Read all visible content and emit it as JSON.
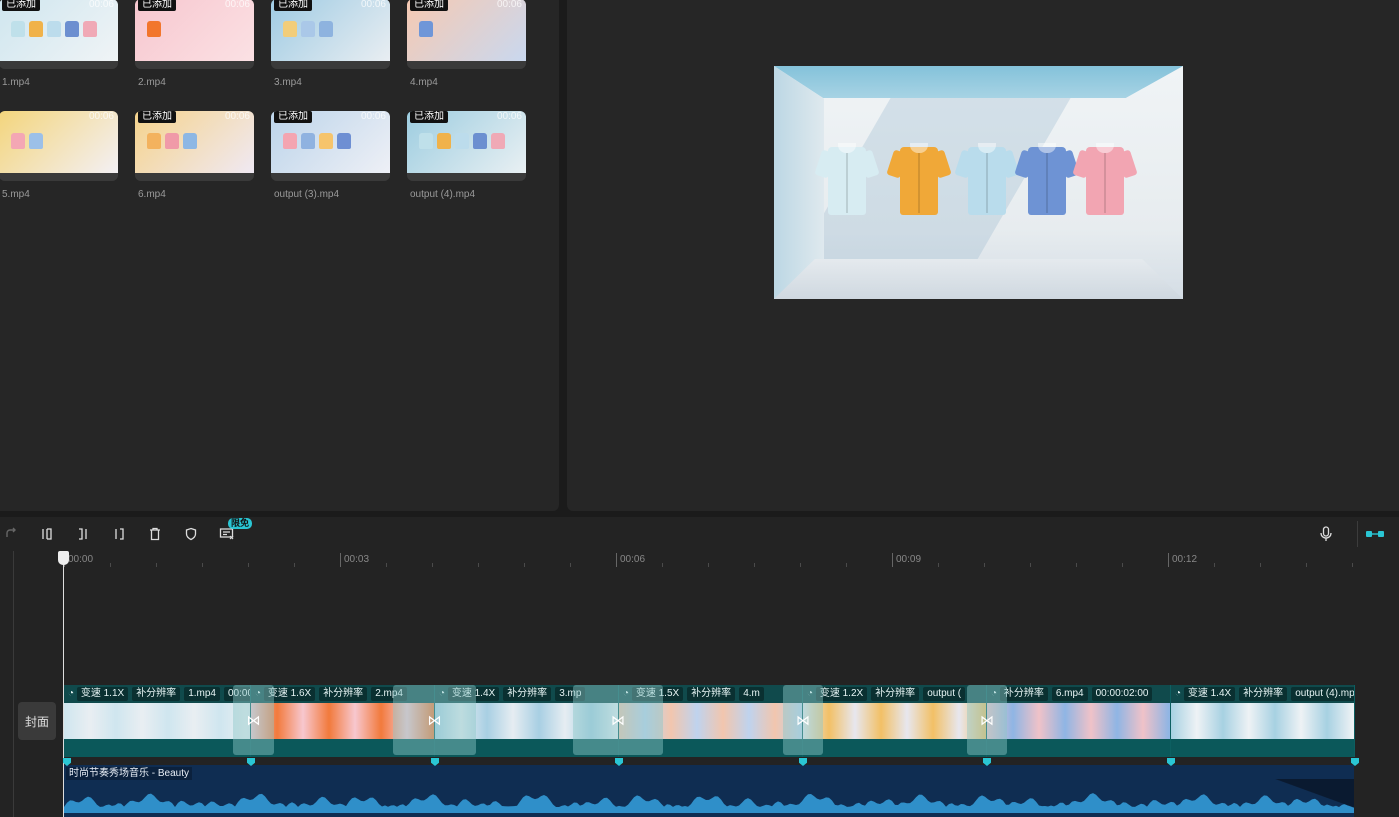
{
  "media": {
    "items": [
      {
        "name": "1.mp4",
        "badge": "已添加",
        "duration": "00:06",
        "colors": [
          "#cfe6ef",
          "#f0f4f6"
        ],
        "shirts": [
          "#bfe0ea",
          "#f0b24a",
          "#bcdcec",
          "#6c8fd0",
          "#f0a9b6"
        ]
      },
      {
        "name": "2.mp4",
        "badge": "已添加",
        "duration": "00:06",
        "colors": [
          "#f7c7cf",
          "#fbe1e4"
        ],
        "shirts": [
          "#f2762c"
        ]
      },
      {
        "name": "3.mp4",
        "badge": "已添加",
        "duration": "00:06",
        "colors": [
          "#9fcbe3",
          "#e9eef2"
        ],
        "shirts": [
          "#f2cd7a",
          "#aac8e8",
          "#8eb3df"
        ]
      },
      {
        "name": "4.mp4",
        "badge": "已添加",
        "duration": "00:06",
        "colors": [
          "#f6c9b2",
          "#c9d8ef"
        ],
        "shirts": [
          "#6f96d8"
        ]
      },
      {
        "name": "5.mp4",
        "badge": "",
        "duration": "00:06",
        "colors": [
          "#f3d57c",
          "#f3f0f4"
        ],
        "shirts": [
          "#f4a7b4",
          "#9cc0e8"
        ]
      },
      {
        "name": "6.mp4",
        "badge": "已添加",
        "duration": "00:06",
        "colors": [
          "#f5d38c",
          "#f0e9f3"
        ],
        "shirts": [
          "#f3b25e",
          "#f09aa8",
          "#8db7e4"
        ]
      },
      {
        "name": "output (3).mp4",
        "badge": "已添加",
        "duration": "00:06",
        "colors": [
          "#bcd4ea",
          "#eef0f6"
        ],
        "shirts": [
          "#f4a5b1",
          "#8fb2e0",
          "#f6c46c",
          "#6e8fd3"
        ]
      },
      {
        "name": "output (4).mp4",
        "badge": "已添加",
        "duration": "00:06",
        "colors": [
          "#9dcde0",
          "#e9f0f3"
        ],
        "shirts": [
          "#bfe0ea",
          "#f0b24a",
          "#bcdcec",
          "#6c8fd0",
          "#f0a9b6"
        ]
      }
    ]
  },
  "preview": {
    "shirts": [
      "#d7ecf2",
      "#f0a838",
      "#b9dcec",
      "#6e93d4",
      "#f2a5b2"
    ]
  },
  "toolbar": {
    "free_badge": "限免"
  },
  "ruler": {
    "labels": [
      "00:00",
      "00:03",
      "00:06",
      "00:09",
      "00:12"
    ]
  },
  "timeline": {
    "cover_label": "封面",
    "clips": [
      {
        "tags": [
          "变速 1.1X",
          "补分辨率",
          "1.mp4",
          "00:00:0"
        ],
        "colors": [
          "#cfe6ef",
          "#e9eef2"
        ]
      },
      {
        "tags": [
          "变速 1.6X",
          "补分辨率",
          "2.mp4"
        ],
        "colors": [
          "#f7c7cf",
          "#f27a3c"
        ]
      },
      {
        "tags": [
          "变速 1.4X",
          "补分辨率",
          "3.mp"
        ],
        "colors": [
          "#a8cfe3",
          "#e6edf2"
        ]
      },
      {
        "tags": [
          "变速 1.5X",
          "补分辨率",
          "4.m"
        ],
        "colors": [
          "#f2c6ae",
          "#bfd3ee"
        ]
      },
      {
        "tags": [
          "变速 1.2X",
          "补分辨率",
          "output ("
        ],
        "colors": [
          "#e7e7ef",
          "#f2c066"
        ]
      },
      {
        "tags": [
          "补分辨率",
          "6.mp4",
          "00:00:02:00"
        ],
        "colors": [
          "#f0c2c8",
          "#8fb5e4"
        ]
      },
      {
        "tags": [
          "变速 1.4X",
          "补分辨率",
          "output (4).mp4"
        ],
        "colors": [
          "#a7d1e2",
          "#eef2f5"
        ]
      }
    ],
    "audio_label": "时尚节奏秀场音乐 - Beauty"
  }
}
